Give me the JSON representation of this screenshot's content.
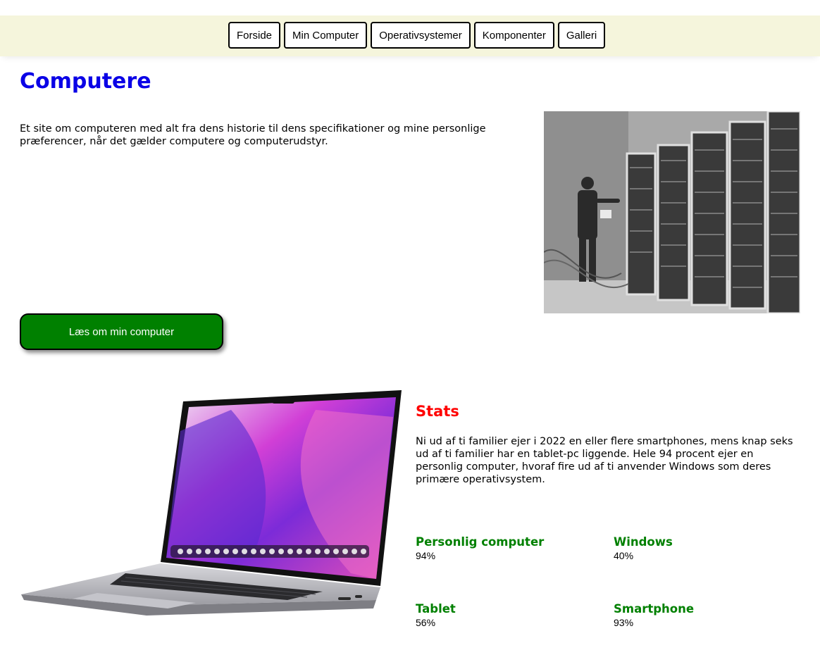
{
  "nav": {
    "items": [
      {
        "label": "Forside"
      },
      {
        "label": "Min Computer"
      },
      {
        "label": "Operativsystemer"
      },
      {
        "label": "Komponenter"
      },
      {
        "label": "Galleri"
      }
    ]
  },
  "hero": {
    "title": "Computere",
    "intro": "Et site om computeren med alt fra dens historie til dens specifikationer og mine personlige præferencer, når det gælder computere og computerudstyr.",
    "cta_label": "Læs om min computer",
    "cta_color": "#008000"
  },
  "stats": {
    "title": "Stats",
    "text": "Ni ud af ti familier ejer i 2022 en eller flere smartphones, mens knap seks ud af ti familier har en tablet-pc liggende. Hele 94 procent ejer en personlig computer, hvoraf fire ud af ti anvender Windows som deres primære operativsystem.",
    "items": [
      {
        "label": "Personlig computer",
        "value": "94%"
      },
      {
        "label": "Windows",
        "value": "40%"
      },
      {
        "label": "Tablet",
        "value": "56%"
      },
      {
        "label": "Smartphone",
        "value": "93%"
      }
    ]
  },
  "colors": {
    "title": "#0a00e6",
    "stats_title": "#ff0000",
    "stat_label": "#008000",
    "nav_bg": "#f5f5dc"
  }
}
